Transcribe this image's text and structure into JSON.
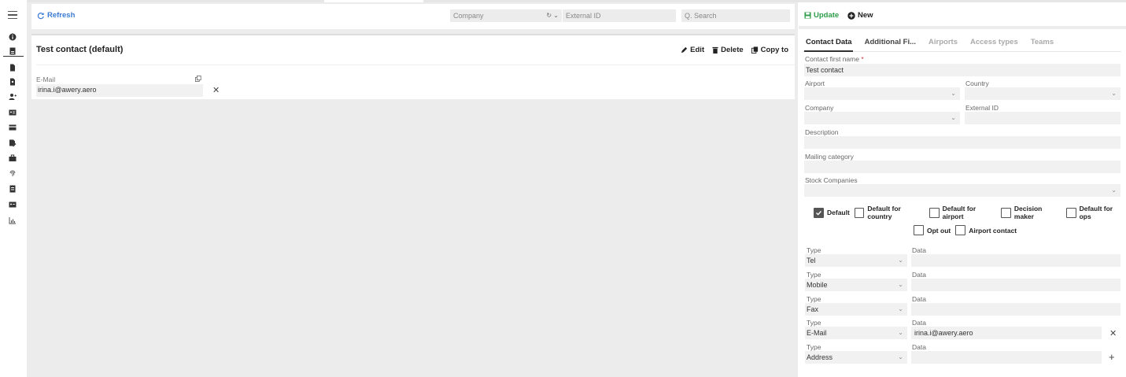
{
  "toolbar": {
    "refresh_label": "Refresh",
    "company_placeholder": "Company",
    "external_id_placeholder": "External ID",
    "search_placeholder": "Q. Search"
  },
  "card": {
    "title": "Test contact (default)",
    "edit_label": "Edit",
    "delete_label": "Delete",
    "copy_label": "Copy to",
    "email_label": "E-Mail",
    "email_value": "irina.i@awery.aero"
  },
  "panel": {
    "update_label": "Update",
    "new_label": "New",
    "tabs": [
      "Contact Data",
      "Additional Fi...",
      "Airports",
      "Access types",
      "Teams"
    ],
    "first_name_label": "Contact first name",
    "first_name_required": "*",
    "first_name_value": "Test contact",
    "airport_label": "Airport",
    "country_label": "Country",
    "company_label": "Company",
    "external_id_label": "External ID",
    "description_label": "Description",
    "mailing_label": "Mailing category",
    "stock_label": "Stock Companies",
    "checkboxes_row1": [
      {
        "label": "Default",
        "checked": true
      },
      {
        "label": "Default for country",
        "checked": false
      },
      {
        "label": "Default for airport",
        "checked": false
      },
      {
        "label": "Decision maker",
        "checked": false
      },
      {
        "label": "Default for ops",
        "checked": false
      }
    ],
    "checkboxes_row2": [
      {
        "label": "Opt out",
        "checked": false
      },
      {
        "label": "Airport contact",
        "checked": false
      }
    ],
    "type_label": "Type",
    "data_label": "Data",
    "contacts": [
      {
        "type": "Tel",
        "data": ""
      },
      {
        "type": "Mobile",
        "data": ""
      },
      {
        "type": "Fax",
        "data": ""
      },
      {
        "type": "E-Mail",
        "data": "irina.i@awery.aero"
      },
      {
        "type": "Address",
        "data": ""
      }
    ]
  },
  "colors": {
    "accent_blue": "#3a7bd5",
    "accent_green": "#2e9c4a",
    "bg_gray": "#ececec"
  }
}
